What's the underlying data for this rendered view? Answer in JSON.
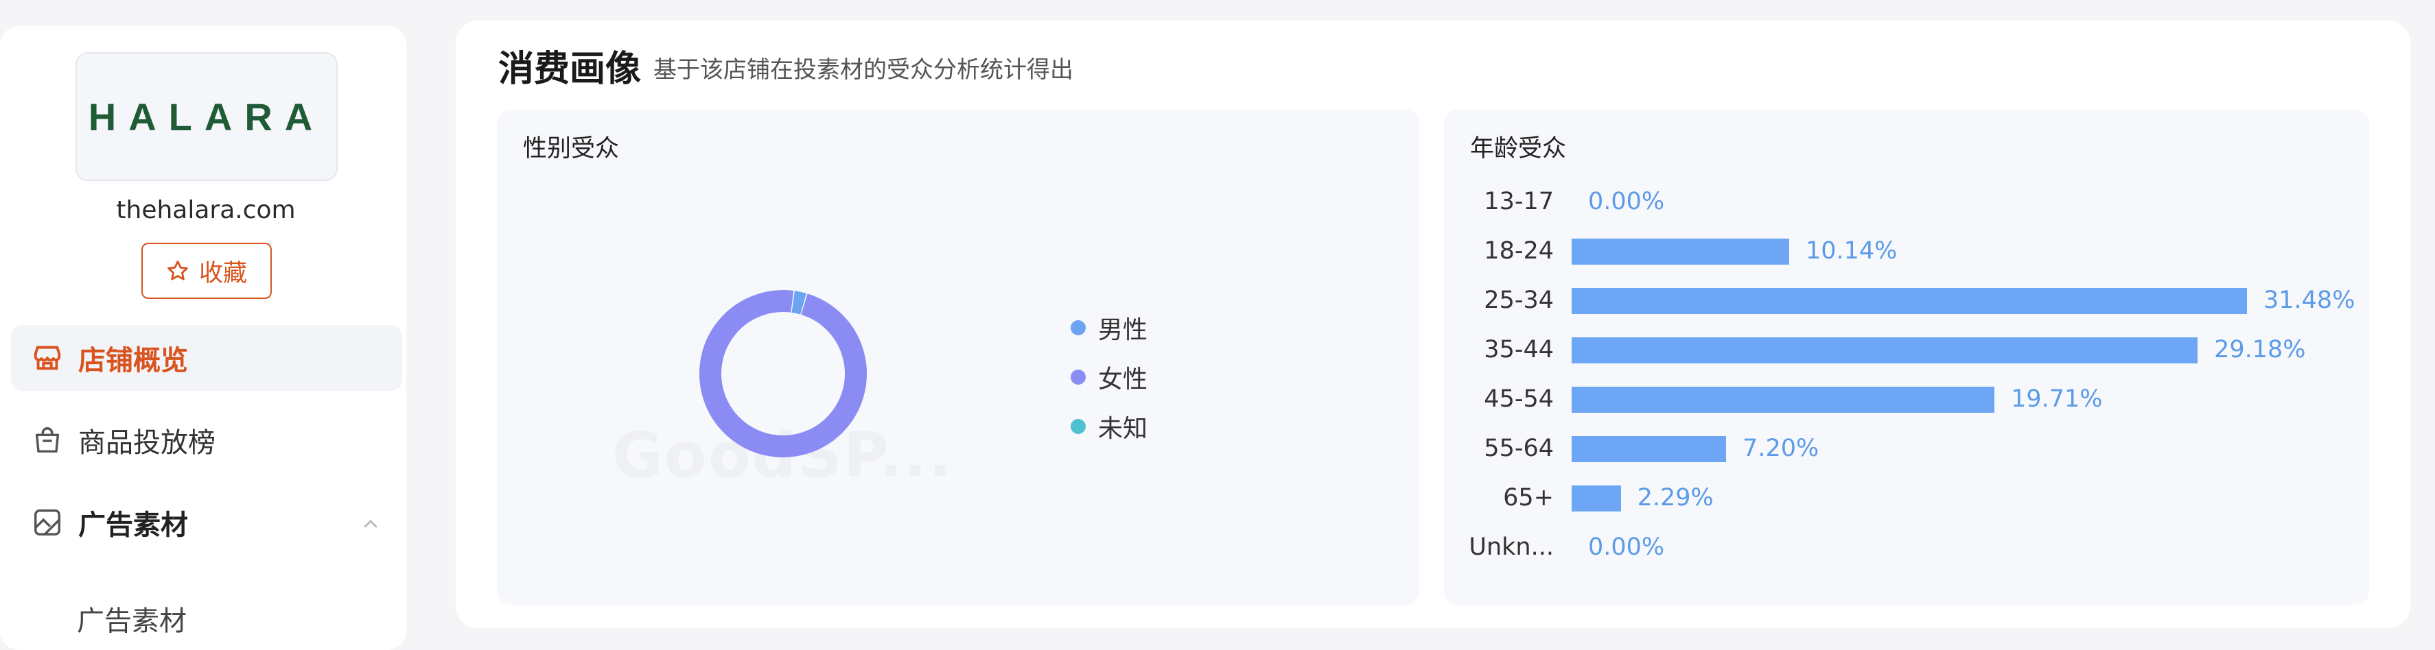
{
  "sidebar": {
    "logo_text": "HALARA",
    "domain": "thehalara.com",
    "favorite_label": "收藏",
    "nav": [
      {
        "label": "店铺概览",
        "icon": "store-icon"
      },
      {
        "label": "商品投放榜",
        "icon": "shopping-bag-icon"
      },
      {
        "label": "广告素材",
        "icon": "image-icon"
      }
    ],
    "sub_item": "广告素材"
  },
  "main": {
    "title": "消费画像",
    "subtitle": "基于该店铺在投素材的受众分析统计得出",
    "watermark": "GoodSP..."
  },
  "gender": {
    "title": "性别受众",
    "legend": [
      {
        "label": "男性",
        "color": "#6ba4f0"
      },
      {
        "label": "女性",
        "color": "#8a8cf4"
      },
      {
        "label": "未知",
        "color": "#4fc0cf"
      }
    ],
    "chart_data": {
      "type": "pie",
      "donut": true,
      "slices": [
        {
          "label": "男性",
          "value": 2.5,
          "color": "#6ba4f0"
        },
        {
          "label": "女性",
          "value": 97.5,
          "color": "#8a8cf4"
        },
        {
          "label": "未知",
          "value": 0,
          "color": "#4fc0cf"
        }
      ]
    }
  },
  "age": {
    "title": "年龄受众",
    "bar_color": "#6da6f5",
    "label_color": "#5b9be8",
    "chart_data": {
      "type": "bar",
      "orientation": "horizontal",
      "categories": [
        "13-17",
        "18-24",
        "25-34",
        "35-44",
        "45-54",
        "55-64",
        "65+",
        "Unkn..."
      ],
      "values": [
        0.0,
        10.14,
        31.48,
        29.18,
        19.71,
        7.2,
        2.29,
        0.0
      ],
      "value_labels": [
        "0.00%",
        "10.14%",
        "31.48%",
        "29.18%",
        "19.71%",
        "7.20%",
        "2.29%",
        "0.00%"
      ]
    }
  }
}
